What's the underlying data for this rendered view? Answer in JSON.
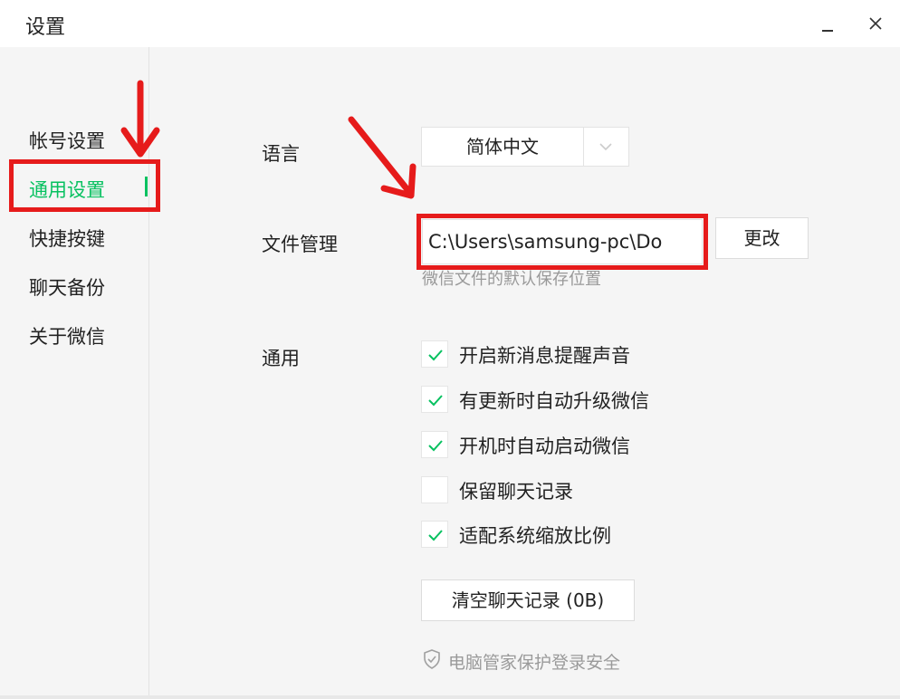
{
  "window": {
    "title": "设置",
    "minimize_label": "_",
    "close_label": "×"
  },
  "sidebar": {
    "items": [
      {
        "label": "帐号设置",
        "active": false
      },
      {
        "label": "通用设置",
        "active": true
      },
      {
        "label": "快捷按键",
        "active": false
      },
      {
        "label": "聊天备份",
        "active": false
      },
      {
        "label": "关于微信",
        "active": false
      }
    ]
  },
  "settings": {
    "language": {
      "label": "语言",
      "value": "简体中文"
    },
    "file_management": {
      "label": "文件管理",
      "path": "C:\\Users\\samsung-pc\\Do",
      "change_button": "更改",
      "hint": "微信文件的默认保存位置"
    },
    "general": {
      "label": "通用",
      "options": [
        {
          "label": "开启新消息提醒声音",
          "checked": true
        },
        {
          "label": "有更新时自动升级微信",
          "checked": true
        },
        {
          "label": "开机时自动启动微信",
          "checked": true
        },
        {
          "label": "保留聊天记录",
          "checked": false
        },
        {
          "label": "适配系统缩放比例",
          "checked": true
        }
      ]
    },
    "clear_button": "清空聊天记录 (0B)",
    "security_text": "电脑管家保护登录安全"
  },
  "colors": {
    "accent": "#07c160",
    "highlight": "#e61b1b"
  },
  "icons": {
    "dropdown": "chevron-down-icon",
    "checkbox": "check-icon",
    "security": "shield-icon",
    "annotation": "red-arrow-icon"
  }
}
